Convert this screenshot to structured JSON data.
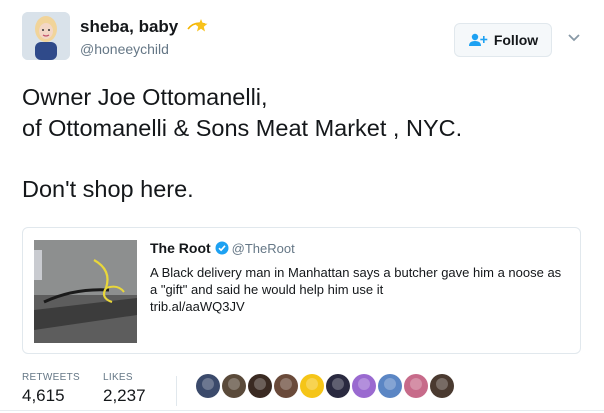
{
  "author": {
    "display_name": "sheba, baby",
    "emoji": "dizzy-star",
    "handle": "@honeeychild"
  },
  "follow_button": {
    "label": "Follow"
  },
  "tweet": {
    "line1": "Owner Joe Ottomanelli,",
    "line2": "of Ottomanelli & Sons Meat Market , NYC.",
    "line3": "Don't shop here."
  },
  "quoted_tweet": {
    "name": "The Root",
    "handle": "@TheRoot",
    "text": "A Black delivery man in Manhattan says a butcher gave him a noose as a \"gift\" and said he would help him use it",
    "link": "trib.al/aaWQ3JV"
  },
  "stats": {
    "retweets_label": "RETWEETS",
    "retweets_value": "4,615",
    "likes_label": "LIKES",
    "likes_value": "2,237"
  },
  "likers": [
    {
      "color": "#3b4a6b"
    },
    {
      "color": "#5a4a3a"
    },
    {
      "color": "#3a2a22"
    },
    {
      "color": "#6a4a3a"
    },
    {
      "color": "#f5c518"
    },
    {
      "color": "#2a2a40"
    },
    {
      "color": "#9a6ad0"
    },
    {
      "color": "#5b86c4"
    },
    {
      "color": "#c76b8a"
    },
    {
      "color": "#4a3a30"
    }
  ],
  "colors": {
    "text": "#14171a",
    "secondary": "#657786",
    "border": "#e1e8ed",
    "accent": "#1da1f2"
  }
}
